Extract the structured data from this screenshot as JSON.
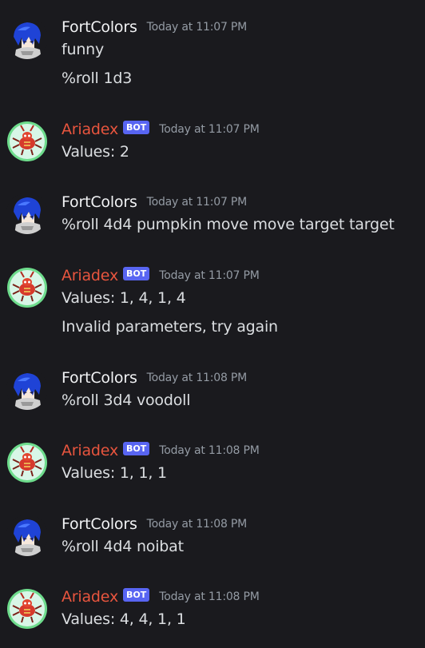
{
  "colors": {
    "background": "#1a1a1e",
    "user_name": "#f2f3f5",
    "bot_name": "#e8553e",
    "bot_tag": "#5865f2",
    "timestamp": "#949ba4",
    "text": "#dbdee1"
  },
  "messages": [
    {
      "author": "FortColors",
      "is_bot": false,
      "avatar_icon": "blue-hair-anime-avatar-icon",
      "timestamp": "Today at 11:07 PM",
      "lines": [
        "funny",
        "%roll 1d3"
      ]
    },
    {
      "author": "Ariadex",
      "is_bot": true,
      "bot_tag": "BOT",
      "avatar_icon": "red-bug-pokemon-avatar-icon",
      "timestamp": "Today at 11:07 PM",
      "lines": [
        "Values: 2"
      ]
    },
    {
      "author": "FortColors",
      "is_bot": false,
      "avatar_icon": "blue-hair-anime-avatar-icon",
      "timestamp": "Today at 11:07 PM",
      "lines": [
        "%roll 4d4 pumpkin move move target target"
      ]
    },
    {
      "author": "Ariadex",
      "is_bot": true,
      "bot_tag": "BOT",
      "avatar_icon": "red-bug-pokemon-avatar-icon",
      "timestamp": "Today at 11:07 PM",
      "lines": [
        "Values: 1, 4, 1, 4",
        "Invalid parameters, try again"
      ]
    },
    {
      "author": "FortColors",
      "is_bot": false,
      "avatar_icon": "blue-hair-anime-avatar-icon",
      "timestamp": "Today at 11:08 PM",
      "lines": [
        "%roll 3d4 voodoll"
      ]
    },
    {
      "author": "Ariadex",
      "is_bot": true,
      "bot_tag": "BOT",
      "avatar_icon": "red-bug-pokemon-avatar-icon",
      "timestamp": "Today at 11:08 PM",
      "lines": [
        "Values: 1, 1, 1"
      ]
    },
    {
      "author": "FortColors",
      "is_bot": false,
      "avatar_icon": "blue-hair-anime-avatar-icon",
      "timestamp": "Today at 11:08 PM",
      "lines": [
        "%roll 4d4 noibat"
      ]
    },
    {
      "author": "Ariadex",
      "is_bot": true,
      "bot_tag": "BOT",
      "avatar_icon": "red-bug-pokemon-avatar-icon",
      "timestamp": "Today at 11:08 PM",
      "lines": [
        "Values: 4, 4, 1, 1"
      ]
    }
  ]
}
